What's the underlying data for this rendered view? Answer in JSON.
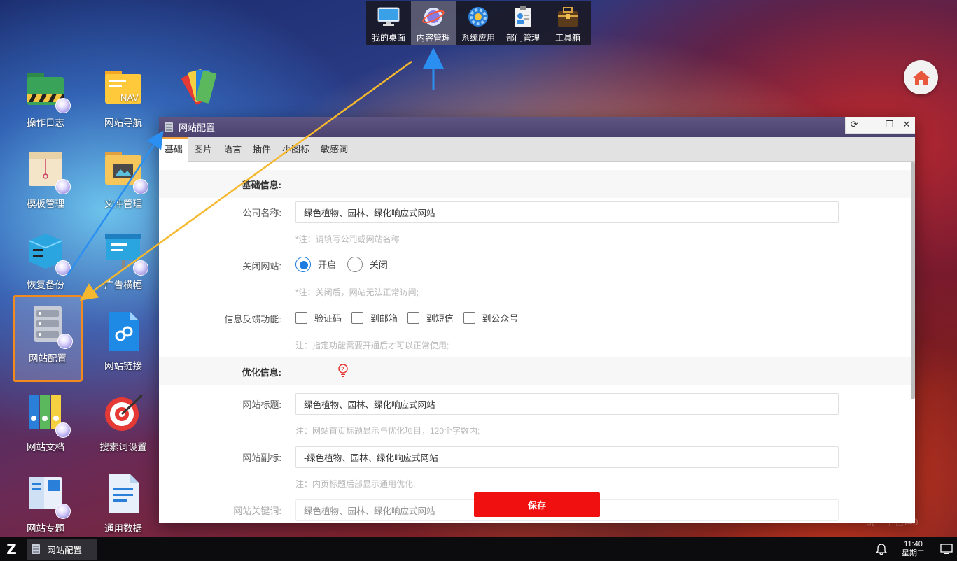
{
  "dock": {
    "items": [
      {
        "label": "我的桌面",
        "icon": "monitor-icon"
      },
      {
        "label": "内容管理",
        "icon": "globe-icon",
        "active": true
      },
      {
        "label": "系统应用",
        "icon": "gear-icon"
      },
      {
        "label": "部门管理",
        "icon": "id-card-icon"
      },
      {
        "label": "工具箱",
        "icon": "toolbox-icon"
      }
    ]
  },
  "desktop": {
    "icons": [
      {
        "label": "操作日志",
        "icon": "folder-log-icon"
      },
      {
        "label": "网站导航",
        "icon": "nav-folder-icon"
      },
      {
        "label": "模板管理",
        "icon": "template-box-icon"
      },
      {
        "label": "文件管理",
        "icon": "file-folder-icon"
      },
      {
        "label": "恢复备份",
        "icon": "server-backup-icon"
      },
      {
        "label": "广告横幅",
        "icon": "banner-icon"
      },
      {
        "label": "网站配置",
        "icon": "server-config-icon",
        "selected": true
      },
      {
        "label": "网站链接",
        "icon": "link-doc-icon"
      },
      {
        "label": "网站文档",
        "icon": "binders-icon"
      },
      {
        "label": "搜索词设置",
        "icon": "target-icon"
      },
      {
        "label": "网站专题",
        "icon": "topic-book-icon"
      },
      {
        "label": "通用数据",
        "icon": "data-doc-icon"
      }
    ]
  },
  "window": {
    "title": "网站配置",
    "tabs": [
      "基础",
      "图片",
      "语言",
      "插件",
      "小图标",
      "敏感词"
    ],
    "active_tab": "基础",
    "basic_section": "基础信息:",
    "company_label": "公司名称:",
    "company_value": "绿色植物、园林、绿化响应式网站",
    "company_hint": "*注：请填写公司或网站名称",
    "close_label": "关闭网站:",
    "open_option": "开启",
    "close_option": "关闭",
    "close_hint": "*注：关闭后，网站无法正常访问;",
    "feedback_label": "信息反馈功能:",
    "feedback_options": [
      "验证码",
      "到邮箱",
      "到短信",
      "到公众号"
    ],
    "feedback_hint": "注：指定功能需要开通后才可以正常使用;",
    "seo_section": "优化信息:",
    "site_title_label": "网站标题:",
    "site_title_value": "绿色植物、园林、绿化响应式网站",
    "site_title_hint": "注：网站首页标题显示与优化项目，120个字数内;",
    "subtitle_label": "网站副标:",
    "subtitle_value": "-绿色植物、园林、绿化响应式网站",
    "subtitle_hint": "注：内页标题后部显示通用优化;",
    "keywords_label": "网站关键词:",
    "keywords_value": "绿色植物、园林、绿化响应式网站",
    "save_label": "保存"
  },
  "taskbar": {
    "start_label": "Z",
    "task_label": "网站配置",
    "time": "11:40",
    "weekday": "星期二"
  },
  "watermark": "统一平台t40",
  "colors": {
    "accent_blue": "#1e7be0",
    "save_red": "#f01010",
    "selected_orange": "#f28a1e",
    "arrow_yellow": "#f5b82e",
    "arrow_blue": "#2a8ff0"
  }
}
